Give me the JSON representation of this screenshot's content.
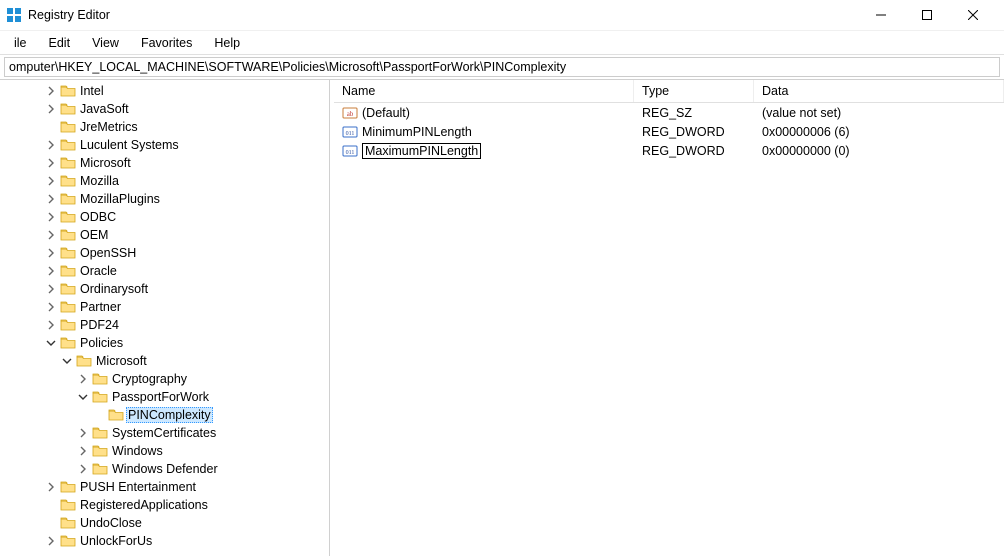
{
  "window": {
    "title": "Registry Editor"
  },
  "menu": {
    "file": "ile",
    "edit": "Edit",
    "view": "View",
    "favorites": "Favorites",
    "help": "Help"
  },
  "address": {
    "value": "omputer\\HKEY_LOCAL_MACHINE\\SOFTWARE\\Policies\\Microsoft\\PassportForWork\\PINComplexity"
  },
  "tree": {
    "nodes": [
      {
        "label": "Intel",
        "depth": 0,
        "exp": ">"
      },
      {
        "label": "JavaSoft",
        "depth": 0,
        "exp": ">"
      },
      {
        "label": "JreMetrics",
        "depth": 0,
        "exp": ""
      },
      {
        "label": "Luculent Systems",
        "depth": 0,
        "exp": ">"
      },
      {
        "label": "Microsoft",
        "depth": 0,
        "exp": ">"
      },
      {
        "label": "Mozilla",
        "depth": 0,
        "exp": ">"
      },
      {
        "label": "MozillaPlugins",
        "depth": 0,
        "exp": ">"
      },
      {
        "label": "ODBC",
        "depth": 0,
        "exp": ">"
      },
      {
        "label": "OEM",
        "depth": 0,
        "exp": ">"
      },
      {
        "label": "OpenSSH",
        "depth": 0,
        "exp": ">"
      },
      {
        "label": "Oracle",
        "depth": 0,
        "exp": ">"
      },
      {
        "label": "Ordinarysoft",
        "depth": 0,
        "exp": ">"
      },
      {
        "label": "Partner",
        "depth": 0,
        "exp": ">"
      },
      {
        "label": "PDF24",
        "depth": 0,
        "exp": ">"
      },
      {
        "label": "Policies",
        "depth": 0,
        "exp": "v"
      },
      {
        "label": "Microsoft",
        "depth": 1,
        "exp": "v"
      },
      {
        "label": "Cryptography",
        "depth": 2,
        "exp": ">"
      },
      {
        "label": "PassportForWork",
        "depth": 2,
        "exp": "v"
      },
      {
        "label": "PINComplexity",
        "depth": 3,
        "exp": "",
        "selected": true
      },
      {
        "label": "SystemCertificates",
        "depth": 2,
        "exp": ">"
      },
      {
        "label": "Windows",
        "depth": 2,
        "exp": ">"
      },
      {
        "label": "Windows Defender",
        "depth": 2,
        "exp": ">"
      },
      {
        "label": "PUSH Entertainment",
        "depth": 0,
        "exp": ">"
      },
      {
        "label": "RegisteredApplications",
        "depth": 0,
        "exp": ""
      },
      {
        "label": "UndoClose",
        "depth": 0,
        "exp": ""
      },
      {
        "label": "UnlockForUs",
        "depth": 0,
        "exp": ">"
      }
    ]
  },
  "list": {
    "headers": {
      "name": "Name",
      "type": "Type",
      "data": "Data"
    },
    "rows": [
      {
        "icon": "sz",
        "name": "(Default)",
        "type": "REG_SZ",
        "data": "(value not set)"
      },
      {
        "icon": "dw",
        "name": "MinimumPINLength",
        "type": "REG_DWORD",
        "data": "0x00000006 (6)"
      },
      {
        "icon": "dw",
        "name": "MaximumPINLength",
        "type": "REG_DWORD",
        "data": "0x00000000 (0)",
        "editing": true
      }
    ]
  }
}
